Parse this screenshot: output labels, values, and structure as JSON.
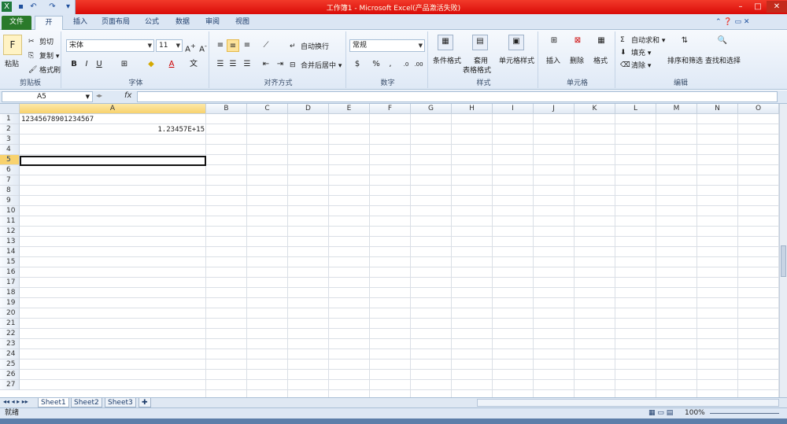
{
  "window": {
    "title": "工作簿1 - Microsoft Excel(产品激活失败)"
  },
  "tabs": [
    "文件",
    "开始",
    "插入",
    "页面布局",
    "公式",
    "数据",
    "审阅",
    "视图"
  ],
  "clipboard": {
    "cut": "剪切",
    "copy": "复制",
    "format_painter": "格式刷",
    "paste": "粘贴",
    "label": "剪贴板"
  },
  "font": {
    "name": "宋体",
    "size": "11",
    "label": "字体"
  },
  "alignment": {
    "wrap": "自动换行",
    "merge": "合并后居中",
    "label": "对齐方式"
  },
  "number": {
    "format": "常规",
    "label": "数字"
  },
  "styles": {
    "conditional": "条件格式",
    "table_fmt_1": "套用",
    "table_fmt_2": "表格格式",
    "cell_styles": "单元格样式",
    "label": "样式"
  },
  "cells": {
    "insert": "插入",
    "delete": "删除",
    "format": "格式",
    "label": "单元格"
  },
  "editing": {
    "autosum": "自动求和",
    "fill": "填充",
    "clear": "清除",
    "sort": "排序和筛选",
    "find": "查找和选择",
    "label": "编辑"
  },
  "formula_bar": {
    "name_box": "A5",
    "fx": "fx",
    "value": ""
  },
  "columns": [
    "A",
    "B",
    "C",
    "D",
    "E",
    "F",
    "G",
    "H",
    "I",
    "J",
    "K",
    "L",
    "M",
    "N",
    "O"
  ],
  "rows": [
    "1",
    "2",
    "3",
    "4",
    "5",
    "6",
    "7",
    "8",
    "9",
    "10",
    "11",
    "12",
    "13",
    "14",
    "15",
    "16",
    "17",
    "18",
    "19",
    "20",
    "21",
    "22",
    "23",
    "24",
    "25",
    "26",
    "27"
  ],
  "cell_values": {
    "A1": "12345678901234567",
    "A2": "1.23457E+15"
  },
  "sheets": [
    "Sheet1",
    "Sheet2",
    "Sheet3"
  ],
  "status": {
    "ready": "就绪",
    "zoom": "100%"
  }
}
